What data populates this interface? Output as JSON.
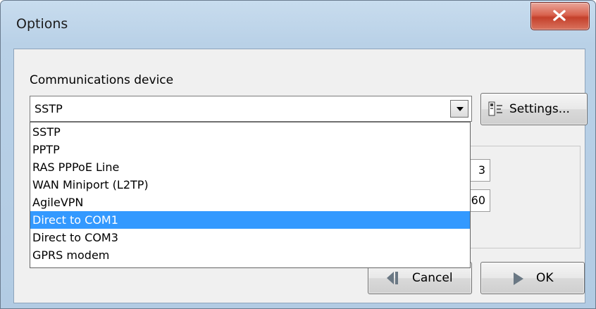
{
  "window": {
    "title": "Options"
  },
  "comms": {
    "label": "Communications device",
    "selected_value": "SSTP",
    "options": [
      "SSTP",
      "PPTP",
      "RAS PPPoE Line",
      "WAN Miniport (L2TP)",
      "AgileVPN",
      "Direct to COM1",
      "Direct to COM3",
      "GPRS modem"
    ],
    "highlighted_option": "Direct to COM1"
  },
  "buttons": {
    "settings": "Settings...",
    "cancel": "Cancel",
    "ok": "OK"
  },
  "fields": {
    "value_a": "3",
    "value_b": "60"
  },
  "icons": {
    "close": "close-icon",
    "dropdown": "chevron-down-icon",
    "settings": "settings-icon",
    "cancel": "rewind-icon",
    "ok": "play-icon"
  }
}
